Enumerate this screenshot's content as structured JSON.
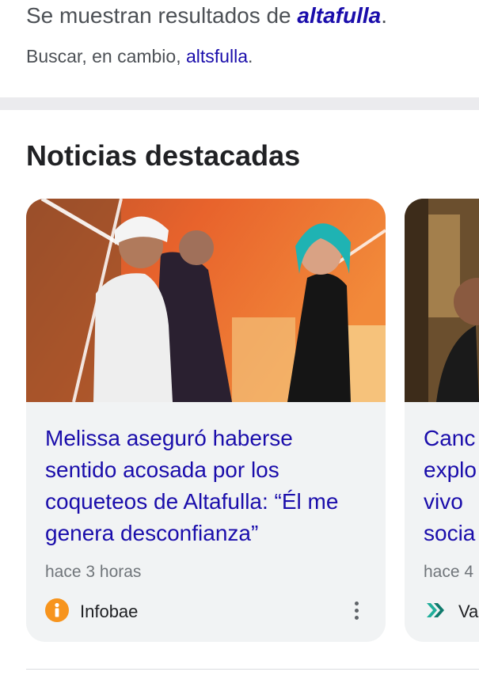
{
  "spelling": {
    "showing_prefix": "Se muestran resultados de ",
    "corrected_query": "altafulla",
    "showing_suffix": ".",
    "instead_prefix": "Buscar, en cambio, ",
    "original_query": "altsfulla",
    "instead_suffix": "."
  },
  "top_stories": {
    "title": "Noticias destacadas",
    "cards": [
      {
        "headline": "Melissa aseguró haberse sentido acosada por los coqueteos de Altafulla: “Él me genera desconfianza”",
        "time": "hace 3 horas",
        "source": "Infobae",
        "source_icon": "infobae-logo-icon"
      },
      {
        "headline": "Canc\nexplo\nvivo\nsocia",
        "time": "hace 4",
        "source": "Va",
        "source_icon": "vanguardia-logo-icon"
      }
    ]
  },
  "colors": {
    "link": "#1a0dab",
    "secondary_text": "#70757a",
    "card_background": "#f1f3f4",
    "infobae_orange": "#f7941d"
  }
}
